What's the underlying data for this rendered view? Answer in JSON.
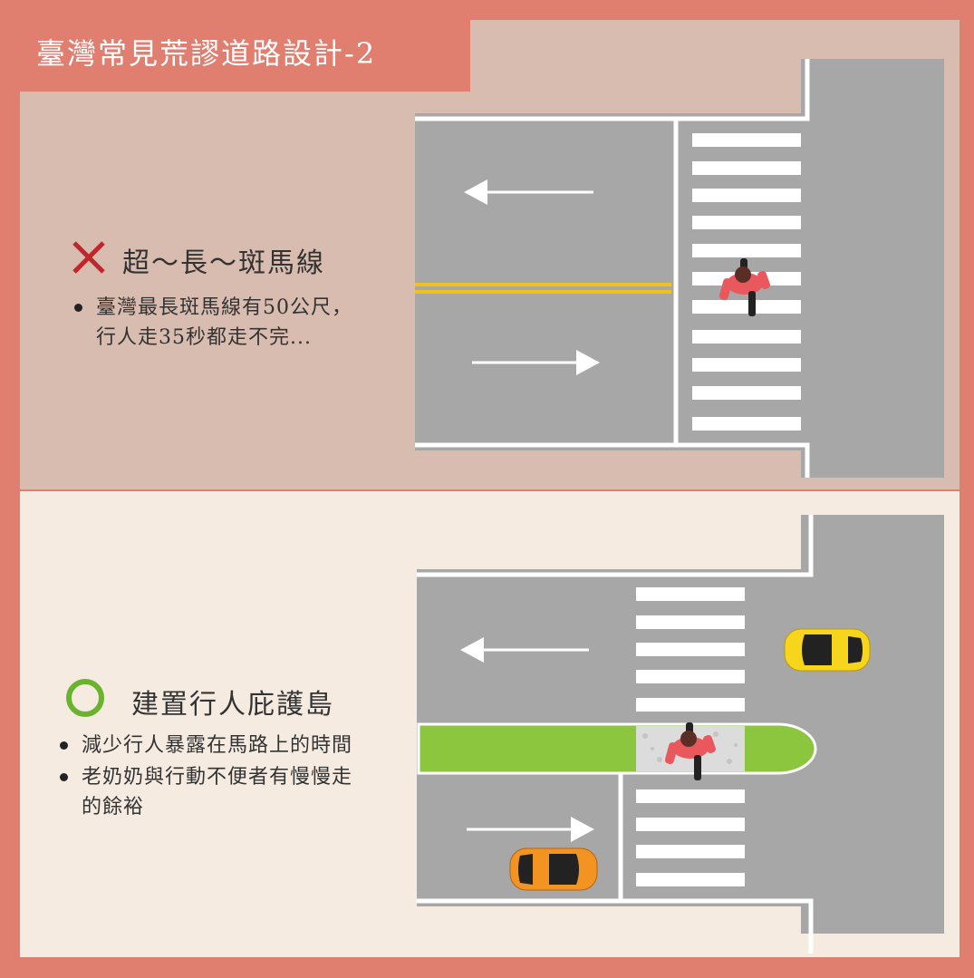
{
  "title": "臺灣常見荒謬道路設計-2",
  "bad": {
    "icon": "cross-icon",
    "heading": "超～長～斑馬線",
    "bullets": [
      "臺灣最長斑馬線有50公尺，",
      "行人走35秒都走不完..."
    ]
  },
  "good": {
    "icon": "circle-icon",
    "heading": "建置行人庇護島",
    "bullets": [
      "減少行人暴露在馬路上的時間",
      "老奶奶與行動不便者有慢慢走",
      "的餘裕"
    ]
  },
  "colors": {
    "frame": "#e07e6f",
    "top_bg": "#d8bcaf",
    "bottom_bg": "#f5ebe1",
    "road": "#a7a7a7",
    "median_line": "#f2c21b",
    "refuge_island": "#8cc63f",
    "cross": "#c0272d",
    "circle": "#6ab42d",
    "car_yellow": "#f7d51d",
    "car_orange": "#f39322",
    "pedestrian": "#e9585d"
  }
}
